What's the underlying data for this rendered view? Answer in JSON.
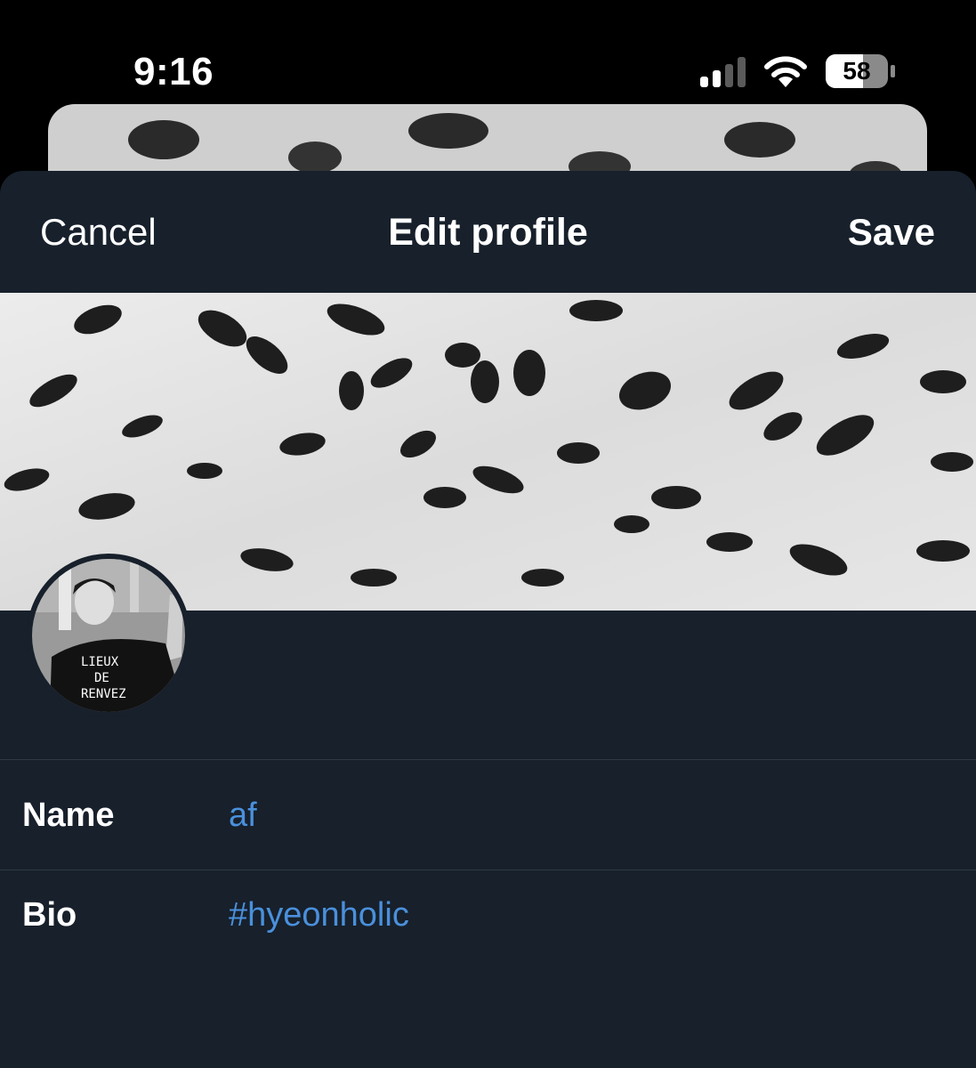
{
  "status_bar": {
    "time": "9:16",
    "battery": "58",
    "icons": [
      "cellular-signal-icon",
      "wifi-icon",
      "battery-icon"
    ]
  },
  "nav": {
    "cancel_label": "Cancel",
    "title": "Edit profile",
    "save_label": "Save"
  },
  "profile": {
    "banner_image": "snow-leopard-fur-pattern",
    "avatar_image": "profile-photo",
    "fields": [
      {
        "label": "Name",
        "value": "af"
      },
      {
        "label": "Bio",
        "value": "#hyeonholic"
      }
    ]
  },
  "colors": {
    "background": "#000000",
    "sheet": "#17202b",
    "accent_link": "#4a90dc",
    "divider": "#2f3a46"
  }
}
